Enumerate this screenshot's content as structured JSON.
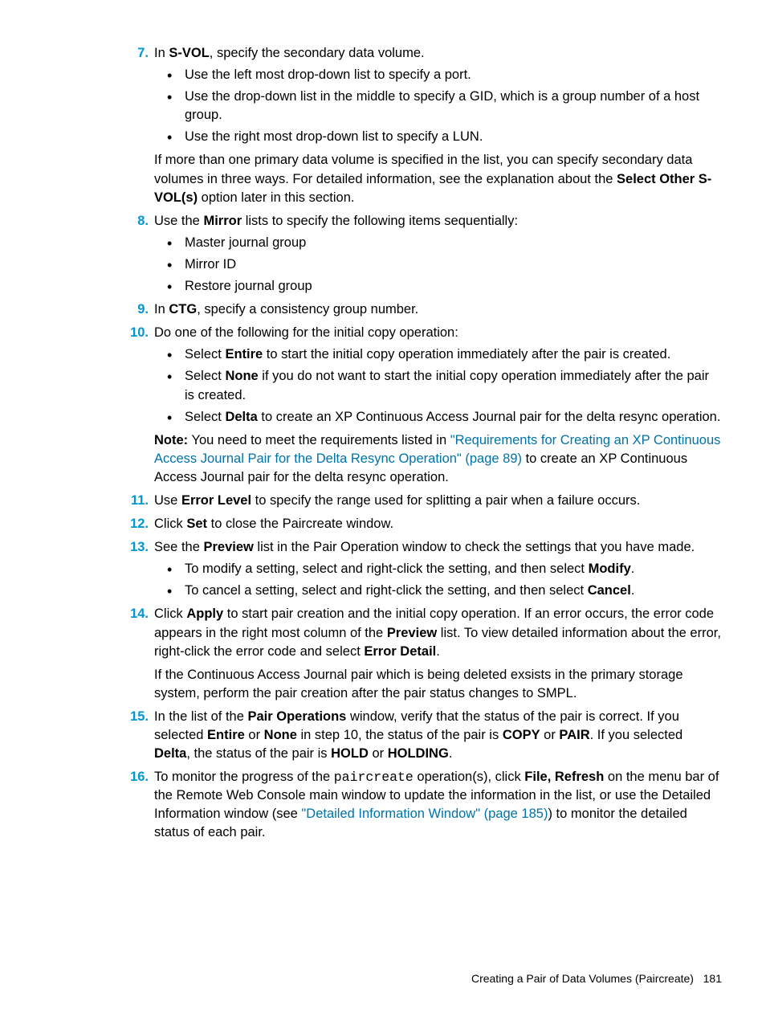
{
  "s7_lead": "In ",
  "s7_bold1": "S-VOL",
  "s7_tail": ", specify the secondary data volume.",
  "s7_b1": "Use the left most drop-down list to specify a port.",
  "s7_b2": "Use the drop-down list in the middle to specify a GID, which is a group number of a host group.",
  "s7_b3": "Use the right most drop-down list to specify a LUN.",
  "s7_p2a": "If more than one primary data volume is specified in the list, you can specify secondary data volumes in three ways. For detailed information, see the explanation about the ",
  "s7_p2b": "Select Other S-VOL(s)",
  "s7_p2c": " option later in this section.",
  "s8_a": "Use the ",
  "s8_b": "Mirror",
  "s8_c": " lists to specify the following items sequentially:",
  "s8_b1": "Master journal group",
  "s8_b2": "Mirror ID",
  "s8_b3": "Restore journal group",
  "s9_a": "In ",
  "s9_b": "CTG",
  "s9_c": ", specify a consistency group number.",
  "s10_a": "Do one of the following for the initial copy operation:",
  "s10_b1a": "Select ",
  "s10_b1b": "Entire",
  "s10_b1c": " to start the initial copy operation immediately after the pair is created.",
  "s10_b2a": "Select ",
  "s10_b2b": "None",
  "s10_b2c": " if you do not want to start the initial copy operation immediately after the pair is created.",
  "s10_b3a": "Select ",
  "s10_b3b": "Delta",
  "s10_b3c": " to create an XP Continuous Access Journal pair for the delta resync operation.",
  "s10_n1": "Note:",
  "s10_n2": " You need to meet the requirements listed in ",
  "s10_link": "\"Requirements for Creating an XP Continuous Access Journal Pair for the Delta Resync Operation\" (page 89)",
  "s10_n3": " to create an XP Continuous Access Journal pair for the delta resync operation.",
  "s11_a": "Use ",
  "s11_b": "Error Level",
  "s11_c": " to specify the range used for splitting a pair when a failure occurs.",
  "s12_a": "Click ",
  "s12_b": "Set",
  "s12_c": " to close the Paircreate window.",
  "s13_a": "See the ",
  "s13_b": "Preview",
  "s13_c": " list in the Pair Operation window to check the settings that you have made.",
  "s13_b1a": "To modify a setting, select and right-click the setting, and then select ",
  "s13_b1b": "Modify",
  "s13_b1c": ".",
  "s13_b2a": "To cancel a setting, select and right-click the setting, and then select ",
  "s13_b2b": "Cancel",
  "s13_b2c": ".",
  "s14_a": "Click ",
  "s14_b": "Apply",
  "s14_c": " to start pair creation and the initial copy operation. If an error occurs, the error code appears in the right most column of the ",
  "s14_d": "Preview",
  "s14_e": " list. To view detailed information about the error, right-click the error code and select ",
  "s14_f": "Error Detail",
  "s14_g": ".",
  "s14_p2": "If the Continuous Access Journal pair which is being deleted exsists in the primary storage system, perform the pair creation after the pair status changes to SMPL.",
  "s15_a": "In the list of the ",
  "s15_b": "Pair Operations",
  "s15_c": " window, verify that the status of the pair is correct. If you selected ",
  "s15_d": "Entire",
  "s15_e": " or ",
  "s15_f": "None",
  "s15_g": " in step 10, the status of the pair is ",
  "s15_h": "COPY",
  "s15_i": " or ",
  "s15_j": "PAIR",
  "s15_k": ". If you selected ",
  "s15_l": "Delta",
  "s15_m": ", the status of the pair is ",
  "s15_n": "HOLD",
  "s15_o": " or ",
  "s15_p": "HOLDING",
  "s15_q": ".",
  "s16_a": "To monitor the progress of the ",
  "s16_mono": "paircreate",
  "s16_b": " operation(s), click ",
  "s16_c": "File, Refresh",
  "s16_d": " on the menu bar of the Remote Web Console main window to update the information in the list, or use the Detailed Information window (see ",
  "s16_link": "\"Detailed Information Window\" (page 185)",
  "s16_e": ") to monitor the detailed status of each pair.",
  "footer_text": "Creating a Pair of Data Volumes (Paircreate)",
  "footer_page": "181"
}
